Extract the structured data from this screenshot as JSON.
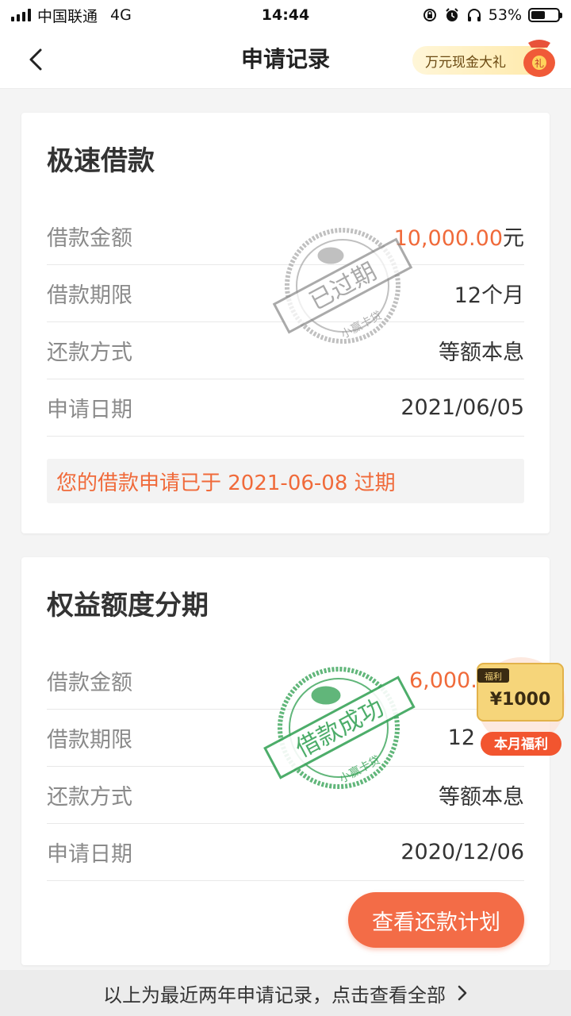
{
  "status_bar": {
    "carrier": "中国联通",
    "network": "4G",
    "time": "14:44",
    "battery": "53%",
    "battery_level": 0.53
  },
  "nav": {
    "title": "申请记录",
    "back_icon": "chevron-left-icon",
    "promo_label": "万元现金大礼",
    "promo_bag_char": "礼"
  },
  "records": [
    {
      "title": "极速借款",
      "rows": [
        {
          "label": "借款金额",
          "amount": "10,000.00",
          "unit": "元"
        },
        {
          "label": "借款期限",
          "value": "12个月"
        },
        {
          "label": "还款方式",
          "value": "等额本息"
        },
        {
          "label": "申请日期",
          "value": "2021/06/05"
        }
      ],
      "notice": "您的借款申请已于 2021-06-08 过期",
      "stamp": {
        "main": "已过期",
        "sub": "小赢卡贷",
        "color": "#9a9a9a"
      }
    },
    {
      "title": "权益额度分期",
      "rows": [
        {
          "label": "借款金额",
          "amount": "6,000.0"
        },
        {
          "label": "借款期限",
          "value": "12"
        },
        {
          "label": "还款方式",
          "value": "等额本息"
        },
        {
          "label": "申请日期",
          "value": "2020/12/06"
        }
      ],
      "button": "查看还款计划",
      "stamp": {
        "main": "借款成功",
        "sub": "小赢卡贷",
        "color": "#3aa55a"
      }
    }
  ],
  "float_widget": {
    "tag": "福利",
    "amount": "¥1000",
    "label": "本月福利"
  },
  "footer": {
    "text": "以上为最近两年申请记录，点击查看全部"
  },
  "colors": {
    "accent": "#f06a3a",
    "button": "#f36c47",
    "expired_stamp": "#9a9a9a",
    "success_stamp": "#3aa55a"
  }
}
